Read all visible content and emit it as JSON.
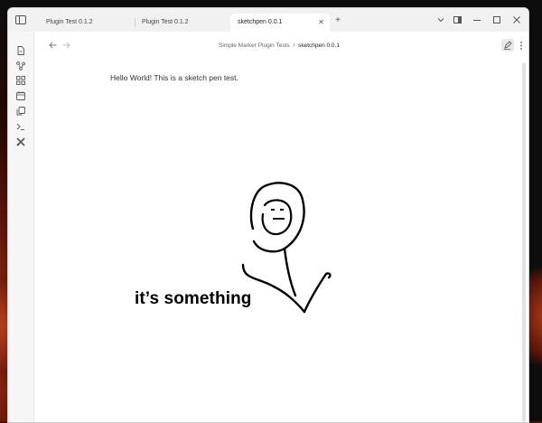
{
  "tabs": [
    {
      "label": "Plugin Test 0.1.2",
      "active": false
    },
    {
      "label": "Plugin Test 0.1.2",
      "active": false
    },
    {
      "label": "sketchpen 0.0.1",
      "active": true
    }
  ],
  "icons": {
    "sidebar_toggle": "sidebar-toggle-icon",
    "new_tab": "plus-icon",
    "tab_list": "chevron-down-icon",
    "layout": "layout-icon",
    "minimize": "minimize-icon",
    "maximize": "maximize-icon",
    "close": "close-icon",
    "back": "arrow-left-icon",
    "forward": "arrow-right-icon",
    "edit": "pencil-icon",
    "more": "more-vertical-icon",
    "ribbon": [
      "file-icon",
      "graph-icon",
      "grid-icon",
      "calendar-icon",
      "copy-icon",
      "terminal-icon",
      "tools-icon"
    ]
  },
  "breadcrumb": {
    "parent": "Simple Marker Plugin Tests",
    "separator": "/",
    "current": "sketchpen 0.0.1"
  },
  "document": {
    "text": "Hello World! This is a sketch pen test.",
    "drawing_caption": "it’s something"
  }
}
